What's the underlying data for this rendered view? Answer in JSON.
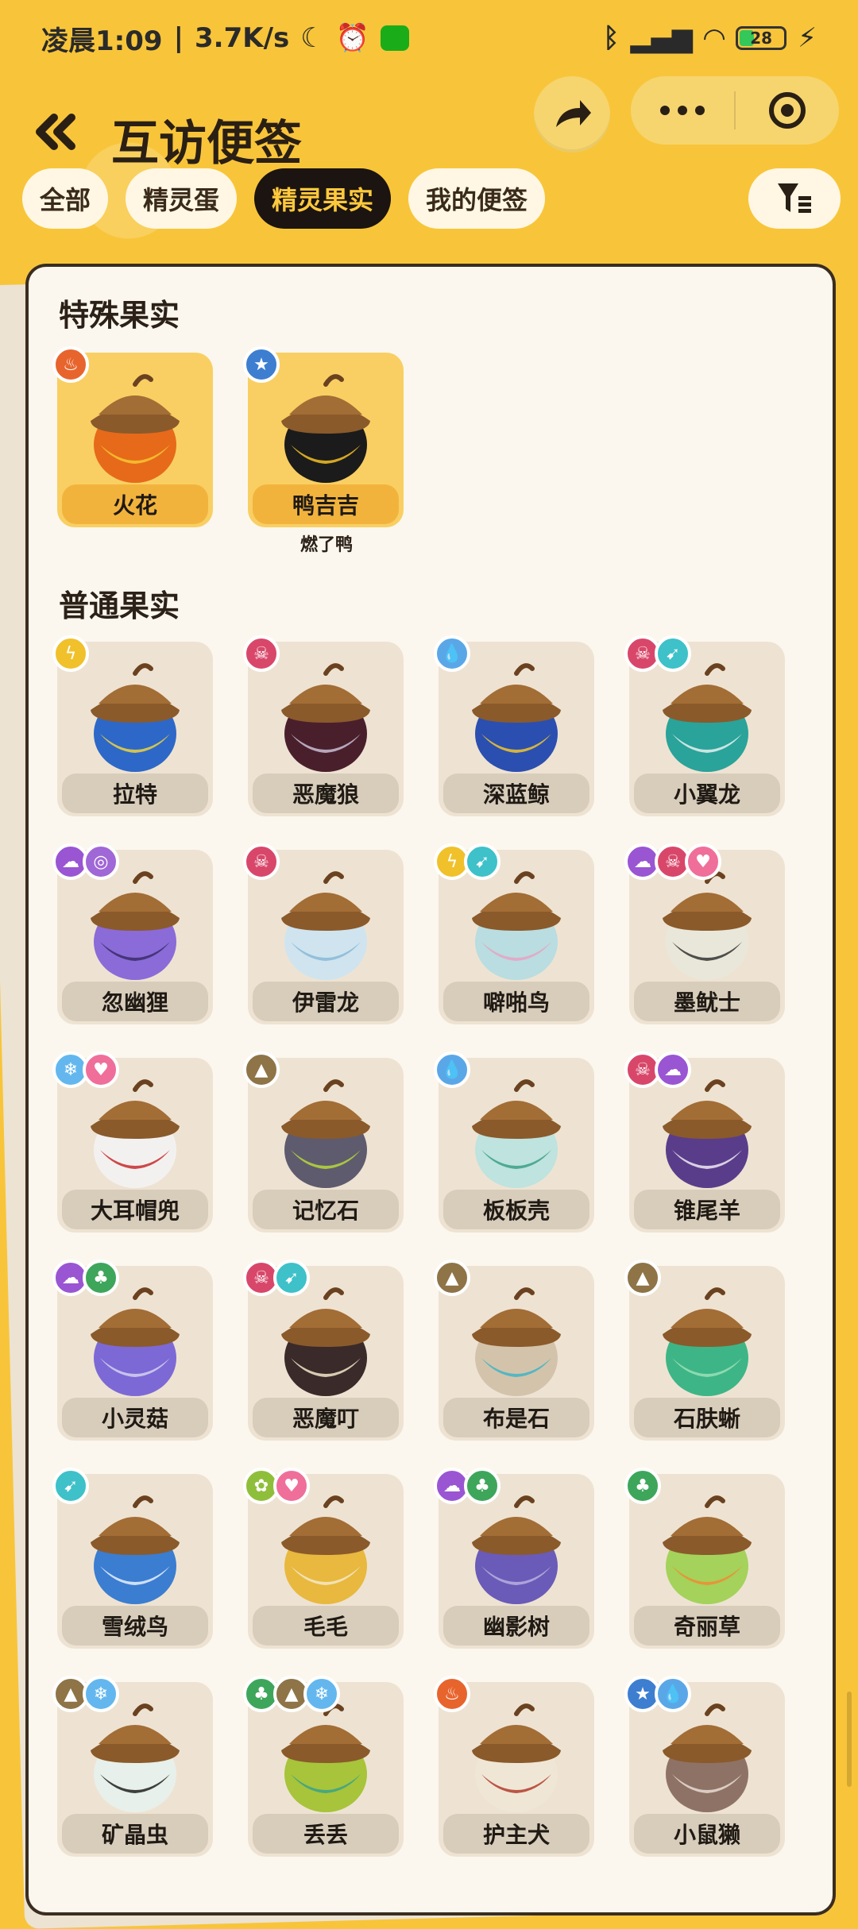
{
  "status_bar": {
    "time": "凌晨1:09",
    "speed": "3.7K/s",
    "battery": "28"
  },
  "header": {
    "title": "互访便签"
  },
  "tabs": [
    {
      "label": "全部",
      "active": false
    },
    {
      "label": "精灵蛋",
      "active": false
    },
    {
      "label": "精灵果实",
      "active": true
    },
    {
      "label": "我的便签",
      "active": false
    }
  ],
  "special": {
    "title": "特殊果实",
    "items": [
      {
        "name": "火花",
        "badges": [
          "fire"
        ],
        "colors": [
          "#e66a1a",
          "#f6c531"
        ]
      },
      {
        "name": "鸭吉吉",
        "sub": "燃了鸭",
        "badges": [
          "star"
        ],
        "colors": [
          "#1b1b1b",
          "#f5c026"
        ]
      }
    ]
  },
  "normal": {
    "title": "普通果实",
    "items": [
      {
        "name": "拉特",
        "badges": [
          "electric"
        ],
        "colors": [
          "#2d68c8",
          "#f1d43b"
        ]
      },
      {
        "name": "恶魔狼",
        "badges": [
          "demon"
        ],
        "colors": [
          "#4a1f2c",
          "#c9c0d5"
        ]
      },
      {
        "name": "深蓝鲸",
        "badges": [
          "water"
        ],
        "colors": [
          "#2b4fb0",
          "#f3c52a"
        ]
      },
      {
        "name": "小翼龙",
        "badges": [
          "demon",
          "wing"
        ],
        "colors": [
          "#2aa39a",
          "#e6f1ee"
        ]
      },
      {
        "name": "忽幽狸",
        "badges": [
          "ghost",
          "psychic"
        ],
        "colors": [
          "#8a6bd8",
          "#3a2c6a"
        ]
      },
      {
        "name": "伊雷龙",
        "badges": [
          "demon"
        ],
        "colors": [
          "#cfe4ef",
          "#88b8d6"
        ]
      },
      {
        "name": "噼啪鸟",
        "badges": [
          "electric",
          "wing"
        ],
        "colors": [
          "#b9dde0",
          "#e7a2c4"
        ]
      },
      {
        "name": "墨鱿士",
        "badges": [
          "ghost",
          "demon",
          "love"
        ],
        "colors": [
          "#e9e7d9",
          "#333333"
        ]
      },
      {
        "name": "大耳帽兜",
        "badges": [
          "ice",
          "love"
        ],
        "colors": [
          "#f3f1f0",
          "#c62b2b"
        ]
      },
      {
        "name": "记忆石",
        "badges": [
          "earth"
        ],
        "colors": [
          "#5f5b6e",
          "#b6d93a"
        ]
      },
      {
        "name": "板板壳",
        "badges": [
          "water"
        ],
        "colors": [
          "#bfe3de",
          "#3aa086"
        ]
      },
      {
        "name": "锥尾羊",
        "badges": [
          "demon",
          "ghost"
        ],
        "colors": [
          "#5a3d8a",
          "#eeeaf2"
        ]
      },
      {
        "name": "小灵菇",
        "badges": [
          "ghost",
          "grass"
        ],
        "colors": [
          "#7c69d6",
          "#d6d2f0"
        ]
      },
      {
        "name": "恶魔叮",
        "badges": [
          "demon",
          "wing"
        ],
        "colors": [
          "#3a2a2a",
          "#f2e7c9"
        ]
      },
      {
        "name": "布是石",
        "badges": [
          "earth"
        ],
        "colors": [
          "#d4c3ab",
          "#3cb5c5"
        ]
      },
      {
        "name": "石肤蜥",
        "badges": [
          "earth"
        ],
        "colors": [
          "#3eb586",
          "#9ae0b7"
        ]
      },
      {
        "name": "雪绒鸟",
        "badges": [
          "wing"
        ],
        "colors": [
          "#3b7dd1",
          "#e7f1fa"
        ]
      },
      {
        "name": "毛毛",
        "badges": [
          "bug",
          "love"
        ],
        "colors": [
          "#e8b83f",
          "#f3e9c6"
        ]
      },
      {
        "name": "幽影树",
        "badges": [
          "ghost",
          "grass"
        ],
        "colors": [
          "#6a5bb8",
          "#b9b0df"
        ]
      },
      {
        "name": "奇丽草",
        "badges": [
          "grass"
        ],
        "colors": [
          "#a4d25b",
          "#f28b34"
        ]
      },
      {
        "name": "矿晶虫",
        "badges": [
          "earth",
          "ice"
        ],
        "colors": [
          "#e7f0ea",
          "#202020"
        ]
      },
      {
        "name": "丢丢",
        "badges": [
          "grass",
          "earth",
          "ice"
        ],
        "colors": [
          "#a7c43a",
          "#3aa28a"
        ]
      },
      {
        "name": "护主犬",
        "badges": [
          "fire"
        ],
        "colors": [
          "#f0e6d6",
          "#b23b2b"
        ]
      },
      {
        "name": "小鼠獭",
        "badges": [
          "star",
          "water"
        ],
        "colors": [
          "#8f7266",
          "#e9dcd4"
        ]
      }
    ]
  },
  "badge_colors": {
    "fire": "#e8642d",
    "star": "#3d7ed0",
    "electric": "#f0c12a",
    "demon": "#d8476a",
    "water": "#5aa7e8",
    "wing": "#3ec1c9",
    "ghost": "#9a55d3",
    "psychic": "#a067d6",
    "love": "#ef6f9a",
    "ice": "#63b7ee",
    "earth": "#8e7447",
    "grass": "#3ea65a",
    "bug": "#8fbf3a"
  }
}
